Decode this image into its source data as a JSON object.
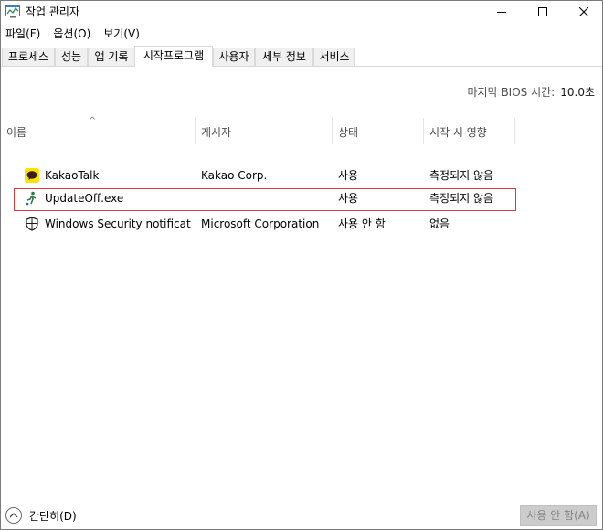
{
  "window": {
    "title": "작업 관리자",
    "icon": "task-manager-icon"
  },
  "menu": [
    "파일(F)",
    "옵션(O)",
    "보기(V)"
  ],
  "tabs": [
    "프로세스",
    "성능",
    "앱 기록",
    "시작프로그램",
    "사용자",
    "세부 정보",
    "서비스"
  ],
  "active_tab": "시작프로그램",
  "bios": {
    "label": "마지막 BIOS 시간:",
    "value": "10.0초"
  },
  "columns": [
    "이름",
    "게시자",
    "상태",
    "시작 시 영향"
  ],
  "rows": [
    {
      "icon": "kakaotalk-icon",
      "name": "KakaoTalk",
      "publisher": "Kakao Corp.",
      "status": "사용",
      "impact": "측정되지 않음"
    },
    {
      "icon": "updateoff-icon",
      "name": "UpdateOff.exe",
      "publisher": "",
      "status": "사용",
      "impact": "측정되지 않음"
    },
    {
      "icon": "shield-icon",
      "name": "Windows Security notificati...",
      "publisher": "Microsoft Corporation",
      "status": "사용 안 함",
      "impact": "없음"
    }
  ],
  "highlight_color": "#d7393f",
  "bottom": {
    "collapse_label": "간단히(D)",
    "disable_button": "사용 안 함(A)"
  }
}
